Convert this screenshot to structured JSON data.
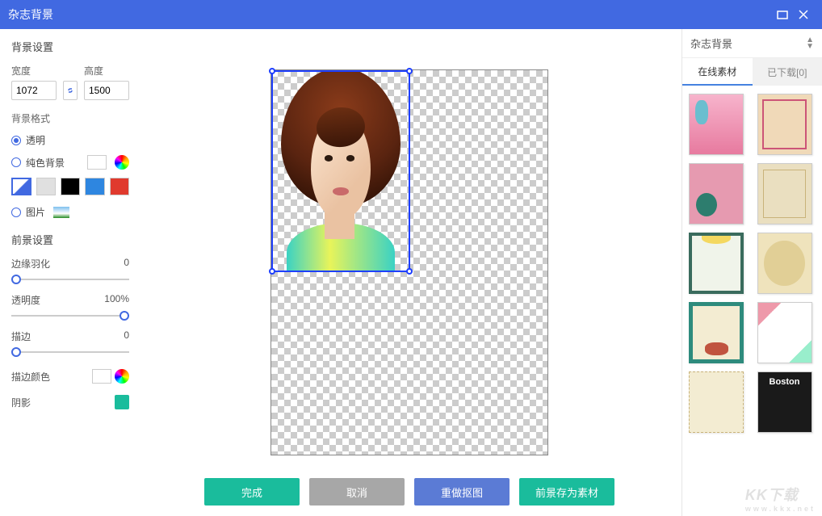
{
  "title": "杂志背景",
  "left": {
    "bg_settings_title": "背景设置",
    "width_label": "宽度",
    "height_label": "高度",
    "width_value": "1072",
    "height_value": "1500",
    "bg_format_title": "背景格式",
    "opt_transparent": "透明",
    "opt_solid": "纯色背景",
    "opt_image": "图片",
    "swatches": [
      "#ffffff",
      "#e0e0e0",
      "#000000",
      "#2e86e0",
      "#e03a2e"
    ],
    "fg_settings_title": "前景设置",
    "feather_label": "边缘羽化",
    "feather_value": "0",
    "opacity_label": "透明度",
    "opacity_value": "100%",
    "stroke_label": "描边",
    "stroke_value": "0",
    "stroke_color_label": "描边颜色",
    "shadow_label": "阴影"
  },
  "buttons": {
    "done": "完成",
    "cancel": "取消",
    "redo_cutout": "重做抠图",
    "save_fg_asset": "前景存为素材"
  },
  "right": {
    "category": "杂志背景",
    "tab_online": "在线素材",
    "tab_downloaded": "已下载[0]",
    "boston_label": "Boston"
  },
  "watermark": {
    "brand": "KK下载",
    "url": "www.kkx.net"
  }
}
